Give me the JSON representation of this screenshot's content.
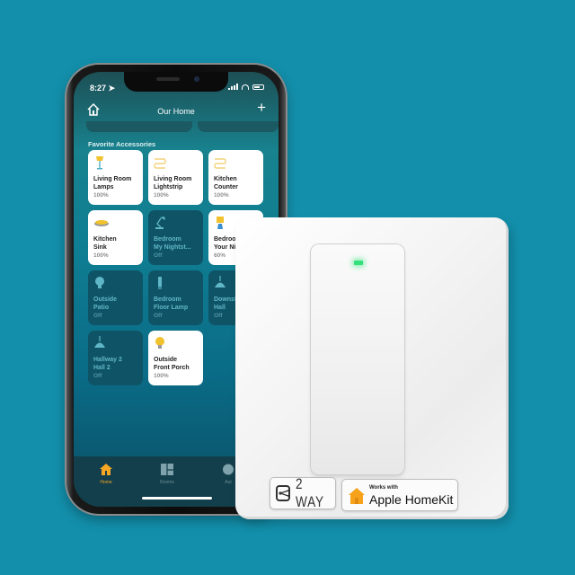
{
  "phone": {
    "status_bar": {
      "time": "8:27",
      "location_arrow": "location-arrow-icon"
    },
    "nav": {
      "title": "Our Home",
      "add_label": "+",
      "home_icon": "home-icon"
    },
    "section_title": "Favorite Accessories",
    "accessories": [
      {
        "name_line1": "Living Room",
        "name_line2": "Lamps",
        "state": "100%",
        "on": true,
        "icon": "floor-lamp-icon"
      },
      {
        "name_line1": "Living Room",
        "name_line2": "Lightstrip",
        "state": "100%",
        "on": true,
        "icon": "lightstrip-icon"
      },
      {
        "name_line1": "Kitchen",
        "name_line2": "Counter",
        "state": "100%",
        "on": true,
        "icon": "lightstrip-icon"
      },
      {
        "name_line1": "Kitchen",
        "name_line2": "Sink",
        "state": "100%",
        "on": true,
        "icon": "ceiling-light-icon"
      },
      {
        "name_line1": "Bedroom",
        "name_line2": "My Nightst...",
        "state": "Off",
        "on": false,
        "icon": "desk-lamp-icon"
      },
      {
        "name_line1": "Bedroom",
        "name_line2": "Your Ni",
        "state": "60%",
        "on": true,
        "icon": "table-lamp-icon"
      },
      {
        "name_line1": "Outside",
        "name_line2": "Patio",
        "state": "Off",
        "on": false,
        "icon": "bulb-icon"
      },
      {
        "name_line1": "Bedroom",
        "name_line2": "Floor Lamp",
        "state": "Off",
        "on": false,
        "icon": "floor-lamp-icon"
      },
      {
        "name_line1": "Downst",
        "name_line2": "Hall",
        "state": "Off",
        "on": false,
        "icon": "pendant-light-icon"
      },
      {
        "name_line1": "Hallway 2",
        "name_line2": "Hall 2",
        "state": "Off",
        "on": false,
        "icon": "pendant-light-icon"
      },
      {
        "name_line1": "Outside",
        "name_line2": "Front Porch",
        "state": "100%",
        "on": true,
        "icon": "bulb-icon"
      }
    ],
    "tabs": [
      {
        "label": "Home",
        "active": true
      },
      {
        "label": "Rooms",
        "active": false
      },
      {
        "label": "Aut",
        "active": false
      }
    ]
  },
  "switch": {
    "led_color": "#33e07c",
    "badge_2way": "2 WAY",
    "badge_homekit_small": "Works with",
    "badge_homekit_big": "Apple HomeKit"
  },
  "colors": {
    "background": "#138fab",
    "accent_on": "#ffffff",
    "tile_off": "#0f5466",
    "active_tab": "#f5a623",
    "homekit_orange": "#f7a21b"
  }
}
